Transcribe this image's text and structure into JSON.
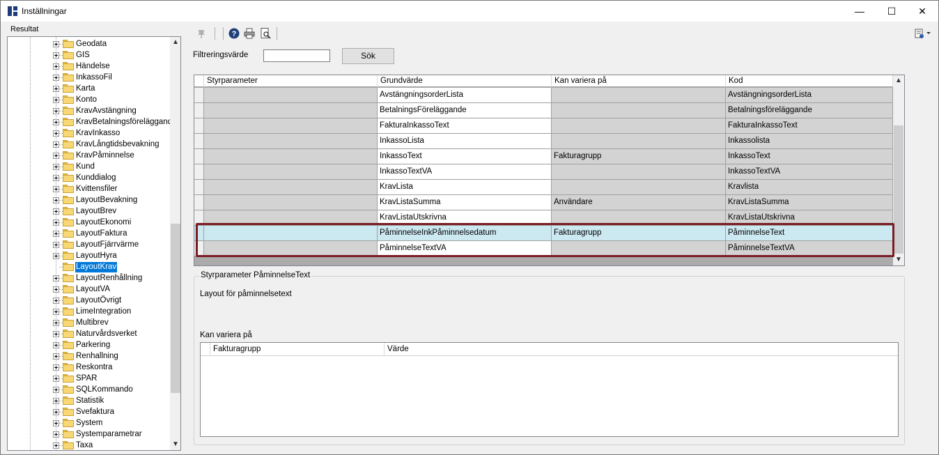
{
  "window": {
    "title": "Inställningar",
    "min_glyph": "—",
    "max_glyph": "☐",
    "close_glyph": "✕"
  },
  "left": {
    "group_title": "Resultat",
    "tree": [
      {
        "label": "Geodata"
      },
      {
        "label": "GIS"
      },
      {
        "label": "Händelse"
      },
      {
        "label": "InkassoFil"
      },
      {
        "label": "Karta"
      },
      {
        "label": "Konto"
      },
      {
        "label": "KravAvstängning"
      },
      {
        "label": "KravBetalningsföreläggande"
      },
      {
        "label": "KravInkasso"
      },
      {
        "label": "KravLångtidsbevakning"
      },
      {
        "label": "KravPåminnelse"
      },
      {
        "label": "Kund"
      },
      {
        "label": "Kunddialog"
      },
      {
        "label": "Kvittensfiler"
      },
      {
        "label": "LayoutBevakning"
      },
      {
        "label": "LayoutBrev"
      },
      {
        "label": "LayoutEkonomi"
      },
      {
        "label": "LayoutFaktura"
      },
      {
        "label": "LayoutFjärrvärme"
      },
      {
        "label": "LayoutHyra"
      },
      {
        "label": "LayoutKrav",
        "selected": true,
        "leaf": true
      },
      {
        "label": "LayoutRenhållning"
      },
      {
        "label": "LayoutVA"
      },
      {
        "label": "LayoutÖvrigt"
      },
      {
        "label": "LimeIntegration"
      },
      {
        "label": "Multibrev"
      },
      {
        "label": "Naturvårdsverket"
      },
      {
        "label": "Parkering"
      },
      {
        "label": "Renhallning"
      },
      {
        "label": "Reskontra"
      },
      {
        "label": "SPAR"
      },
      {
        "label": "SQLKommando"
      },
      {
        "label": "Statistik"
      },
      {
        "label": "Svefaktura"
      },
      {
        "label": "System"
      },
      {
        "label": "Systemparametrar"
      },
      {
        "label": "Taxa"
      }
    ]
  },
  "toolbar": {
    "icons": [
      "pin-icon",
      "help-icon",
      "print-icon",
      "print-preview-icon",
      "settings-menu-icon"
    ]
  },
  "filter": {
    "label": "Filtreringsvärde",
    "value": "",
    "search_button": "Sök"
  },
  "grid": {
    "columns": [
      "Styrparameter",
      "Grundvärde",
      "Kan variera på",
      "Kod"
    ],
    "rows": [
      {
        "styr": "",
        "grund": "AvstängningsorderLista",
        "kan": "",
        "kod": "AvstängningsorderLista"
      },
      {
        "styr": "",
        "grund": "BetalningsFöreläggande",
        "kan": "",
        "kod": "Betalningsföreläggande"
      },
      {
        "styr": "",
        "grund": "FakturaInkassoText",
        "kan": "",
        "kod": "FakturaInkassoText"
      },
      {
        "styr": "",
        "grund": "InkassoLista",
        "kan": "",
        "kod": "Inkassolista"
      },
      {
        "styr": "",
        "grund": "InkassoText",
        "kan": "Fakturagrupp",
        "kod": "InkassoText"
      },
      {
        "styr": "",
        "grund": "InkassoTextVA",
        "kan": "",
        "kod": "InkassoTextVA"
      },
      {
        "styr": "",
        "grund": "KravLista",
        "kan": "",
        "kod": "Kravlista"
      },
      {
        "styr": "",
        "grund": "KravListaSumma",
        "kan": "Användare",
        "kod": "KravListaSumma"
      },
      {
        "styr": "",
        "grund": "KravListaUtskrivna",
        "kan": "",
        "kod": "KravListaUtskrivna"
      },
      {
        "styr": "",
        "grund": "PåminnelseInkPåminnelsedatum",
        "kan": "Fakturagrupp",
        "kod": "PåminnelseText",
        "selected": true
      },
      {
        "styr": "",
        "grund": "PåminnelseTextVA",
        "kan": "",
        "kod": "PåminnelseTextVA"
      }
    ]
  },
  "detail": {
    "title": "Styrparameter PåminnelseText",
    "description": "Layout för påminnelsetext",
    "kan_variera_label": "Kan variera på",
    "sub_columns": [
      "Fakturagrupp",
      "Värde"
    ],
    "sub_rows": []
  }
}
